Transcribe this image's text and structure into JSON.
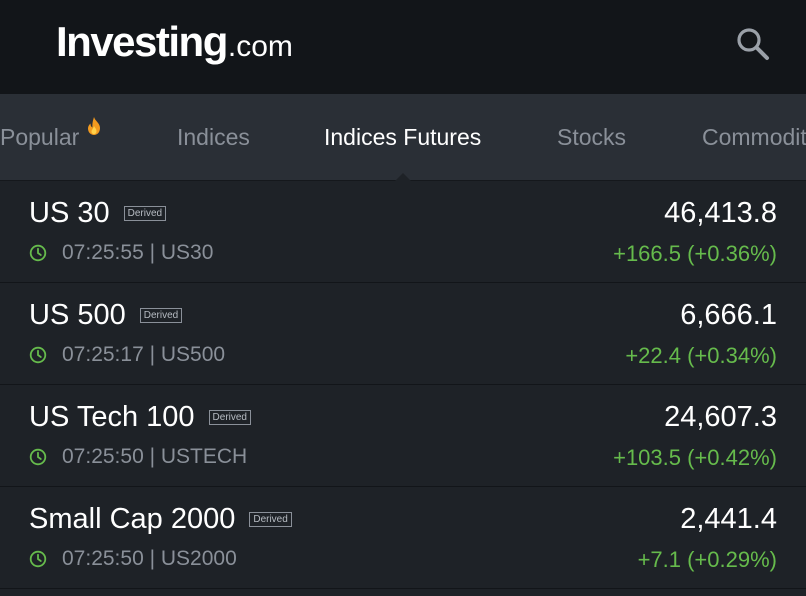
{
  "header": {
    "logo_main": "Investing",
    "logo_suffix": ".com"
  },
  "tabs": [
    {
      "label": "Popular",
      "active": false
    },
    {
      "label": "Indices",
      "active": false
    },
    {
      "label": "Indices Futures",
      "active": true
    },
    {
      "label": "Stocks",
      "active": false
    },
    {
      "label": "Commodit",
      "active": false
    }
  ],
  "rows": [
    {
      "name": "US 30",
      "badge": "Derived",
      "time_symbol": "07:25:55 | US30",
      "price": "46,413.8",
      "change": "+166.5 (+0.36%)"
    },
    {
      "name": "US 500",
      "badge": "Derived",
      "time_symbol": "07:25:17 | US500",
      "price": "6,666.1",
      "change": "+22.4 (+0.34%)"
    },
    {
      "name": "US Tech 100",
      "badge": "Derived",
      "time_symbol": "07:25:50 | USTECH",
      "price": "24,607.3",
      "change": "+103.5 (+0.42%)"
    },
    {
      "name": "Small Cap 2000",
      "badge": "Derived",
      "time_symbol": "07:25:50 | US2000",
      "price": "2,441.4",
      "change": "+7.1 (+0.29%)"
    }
  ],
  "colors": {
    "header_bg": "#121519",
    "tabs_bg": "#2a2f36",
    "list_bg": "#1e2227",
    "positive": "#66bb4c",
    "muted": "#8a9099"
  },
  "icons": [
    "search-icon",
    "fire-icon",
    "clock-icon"
  ]
}
